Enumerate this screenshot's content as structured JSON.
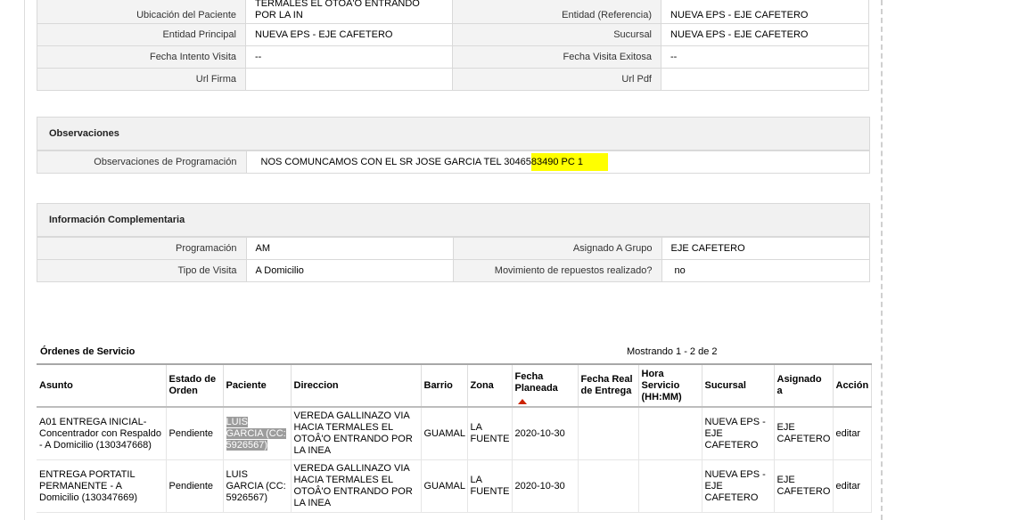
{
  "patient_info": {
    "rows": [
      {
        "l1": "Ubicación del Paciente",
        "v1": "TERMALES EL OTOÂ'O ENTRANDO POR LA IN",
        "l2": "Entidad (Referencia)",
        "v2": "NUEVA EPS - EJE CAFETERO"
      },
      {
        "l1": "Entidad Principal",
        "v1": "NUEVA EPS - EJE CAFETERO",
        "l2": "Sucursal",
        "v2": "NUEVA EPS - EJE CAFETERO"
      },
      {
        "l1": "Fecha Intento Visita",
        "v1": "--",
        "l2": "Fecha Visita Exitosa",
        "v2": "--"
      },
      {
        "l1": "Url Firma",
        "v1": "",
        "l2": "Url Pdf",
        "v2": ""
      }
    ]
  },
  "observaciones": {
    "title": "Observaciones",
    "label": "Observaciones de Programación",
    "value_plain": "NOS COMUNCAMOS CON EL SR JOSE GARCIA TEL 30465",
    "value_highlight": "83490 PC 1"
  },
  "info_complementaria": {
    "title": "Información Complementaria",
    "rows": [
      {
        "l1": "Programación",
        "v1": "AM",
        "l2": "Asignado A Grupo",
        "v2": "EJE CAFETERO"
      },
      {
        "l1": "Tipo de Visita",
        "v1": "A Domicilio",
        "l2": "Movimiento de repuestos realizado?",
        "v2": "no"
      }
    ]
  },
  "orders": {
    "title": "Órdenes de Servicio",
    "showing": "Mostrando 1 - 2 de 2",
    "headers": {
      "asunto": "Asunto",
      "estado": "Estado de Orden",
      "paciente": "Paciente",
      "direccion": "Direccion",
      "barrio": "Barrio",
      "zona": "Zona",
      "fecha_planeada": "Fecha Planeada",
      "fecha_real": "Fecha Real de Entrega",
      "hora": "Hora Servicio (HH:MM)",
      "sucursal": "Sucursal",
      "asignado": "Asignado a",
      "accion": "Acción"
    },
    "rows": [
      {
        "asunto": "A01 ENTREGA INICIAL- Concentrador con Respaldo - A Domicilio (130347668)",
        "estado": "Pendiente",
        "paciente": "LUIS GARCIA (CC: 5926567)",
        "direccion": "VEREDA GALLINAZO VIA HACIA TERMALES EL OTOÂ'O ENTRANDO POR LA INEA",
        "barrio": "GUAMAL",
        "zona": "LA FUENTE",
        "fecha_planeada": "2020-10-30",
        "fecha_real": "",
        "hora": "",
        "sucursal": "NUEVA EPS - EJE CAFETERO",
        "asignado": "EJE CAFETERO",
        "accion": "editar"
      },
      {
        "asunto": "ENTREGA PORTATIL PERMANENTE - A Domicilio (130347669)",
        "estado": "Pendiente",
        "paciente": "LUIS GARCIA (CC: 5926567)",
        "direccion": "VEREDA GALLINAZO VIA HACIA TERMALES EL OTOÂ'O ENTRANDO POR LA INEA",
        "barrio": "GUAMAL",
        "zona": "LA FUENTE",
        "fecha_planeada": "2020-10-30",
        "fecha_real": "",
        "hora": "",
        "sucursal": "NUEVA EPS - EJE CAFETERO",
        "asignado": "EJE CAFETERO",
        "accion": "editar"
      }
    ]
  },
  "colors": {
    "highlight": "#ffff00",
    "sort_arrow": "#cc2200",
    "label_bg": "#f3f3f3",
    "selection": "#9c9c9c"
  }
}
